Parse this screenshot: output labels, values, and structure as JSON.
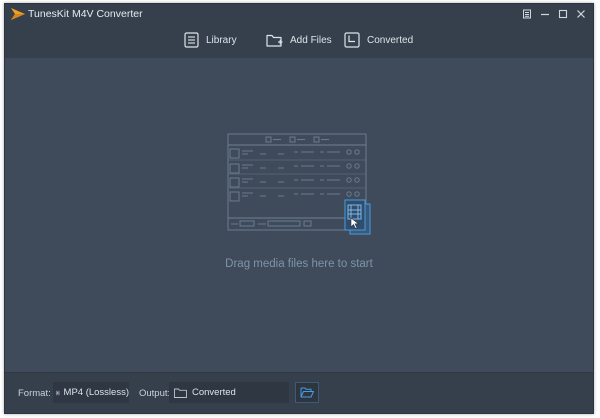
{
  "app": {
    "title": "TunesKit M4V Converter"
  },
  "nav": {
    "library": {
      "label": "Library",
      "icon": "library-icon"
    },
    "add_files": {
      "label": "Add Files",
      "icon": "add-folder-icon"
    },
    "converted": {
      "label": "Converted",
      "icon": "converted-icon"
    }
  },
  "window_controls": [
    "menu-icon",
    "minimize-icon",
    "maximize-icon",
    "close-icon"
  ],
  "main": {
    "drop_hint": "Drag media files here to start"
  },
  "footer": {
    "format_label": "Format:",
    "format_value": "MP4 (Lossless)",
    "output_label": "Output:",
    "output_value": "Converted"
  },
  "colors": {
    "background": "#3f4b5a",
    "header": "#36404c",
    "accent": "#4a9be0",
    "hint_text": "#7f94aa"
  }
}
